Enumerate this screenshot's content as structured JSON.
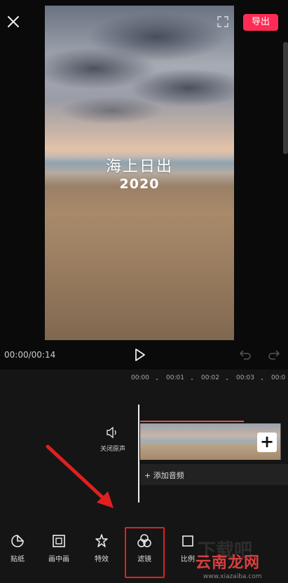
{
  "header": {
    "export_label": "导出"
  },
  "preview": {
    "title": "海上日出",
    "year": "2020"
  },
  "playback": {
    "timecode": "00:00/00:14"
  },
  "timeline": {
    "ruler": [
      "00:00",
      "00:01",
      "00:02",
      "00:03",
      "00:0"
    ],
    "mute_label": "关闭原声",
    "add_audio_label": "+ 添加音频"
  },
  "toolbar": {
    "items": [
      {
        "label": "贴纸",
        "icon": "sticker-icon"
      },
      {
        "label": "画中画",
        "icon": "picture-in-picture-icon"
      },
      {
        "label": "特效",
        "icon": "effects-icon"
      },
      {
        "label": "滤镜",
        "icon": "filter-icon"
      },
      {
        "label": "比例",
        "icon": "ratio-icon"
      }
    ]
  },
  "watermark": {
    "site": "云南龙网",
    "url": "www.xiazaiba.com",
    "ghost": "下载吧"
  },
  "colors": {
    "accent": "#fe2c55",
    "highlight": "#e02020",
    "arrow": "#e02020"
  }
}
